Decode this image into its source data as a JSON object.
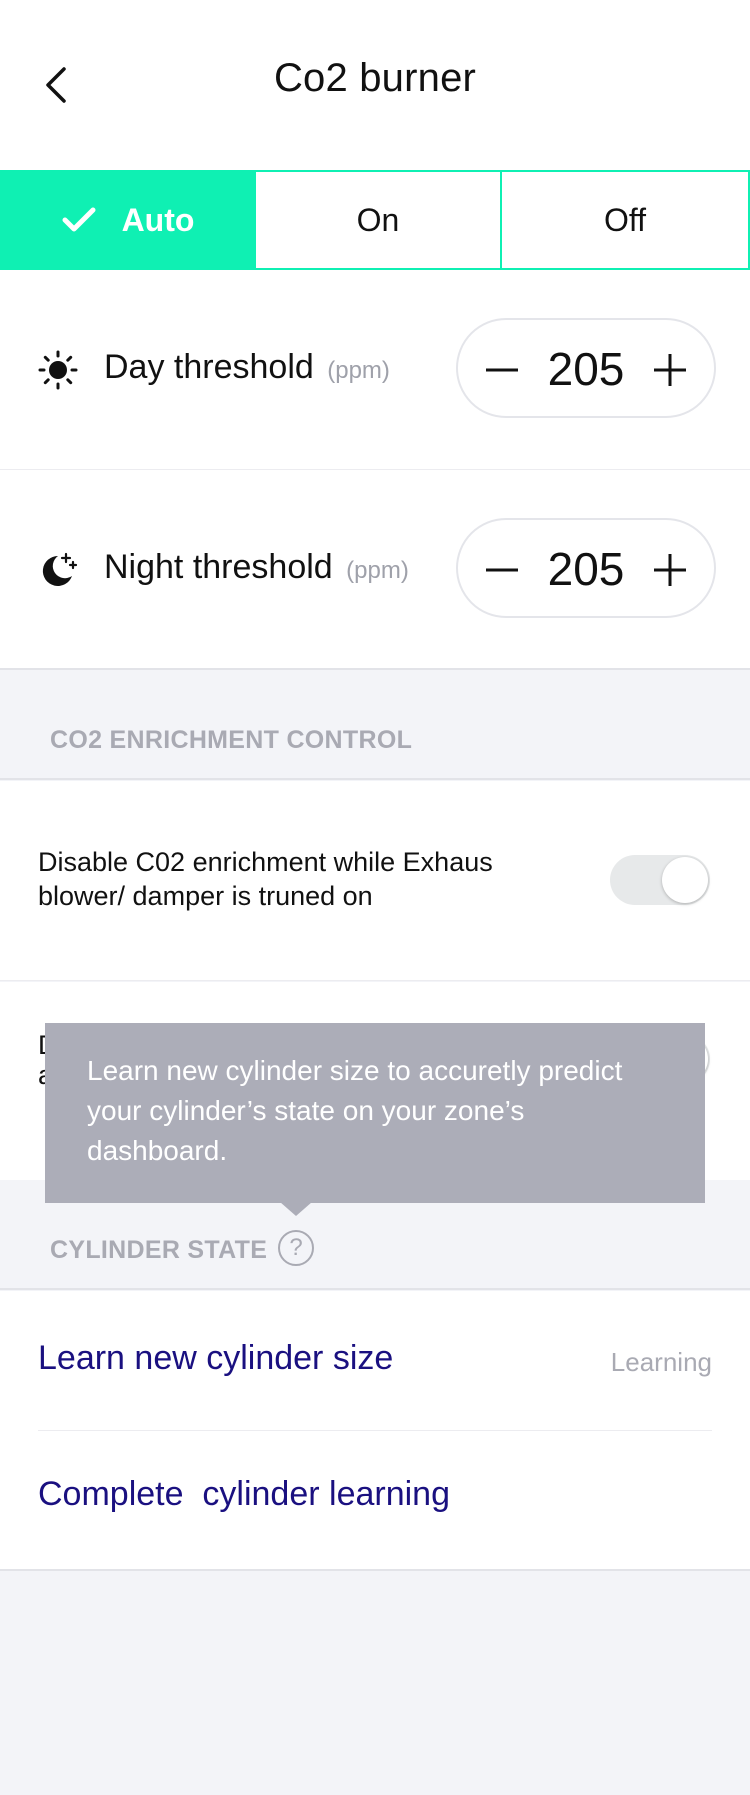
{
  "header": {
    "title": "Co2 burner"
  },
  "mode": {
    "options": [
      "Auto",
      "On",
      "Off"
    ],
    "selected": "Auto"
  },
  "thresholds": {
    "day": {
      "label": "Day threshold",
      "unit": "(ppm)",
      "value": "205"
    },
    "night": {
      "label": "Night threshold",
      "unit": "(ppm)",
      "value": "205"
    }
  },
  "enrichment": {
    "section_title": "CO2 ENRICHMENT CONTROL",
    "toggles": [
      {
        "text": "Disable C02 enrichment while Exhaus blower/ damper is truned on",
        "enabled": true
      },
      {
        "text": "D a",
        "enabled": true
      }
    ]
  },
  "tooltip": {
    "text": "Learn new cylinder size to accuretly predict your cylinder’s state on your zone’s dashboard."
  },
  "cylinder": {
    "section_title": "CYLINDER STATE",
    "help_label": "?",
    "items": [
      {
        "label": "Learn new cylinder size",
        "status": "Learning"
      },
      {
        "label": "Complete  cylinder learning",
        "status": ""
      }
    ]
  },
  "colors": {
    "accent": "#0ff0b3",
    "link": "#1a1080",
    "muted": "#a9aab3",
    "tooltip_bg": "#acadb8"
  },
  "icons": {
    "back": "chevron-left-icon",
    "check": "check-icon",
    "day": "sun-icon",
    "night": "moon-stars-icon",
    "minus": "minus-icon",
    "plus": "plus-icon",
    "help": "question-circle-icon"
  }
}
